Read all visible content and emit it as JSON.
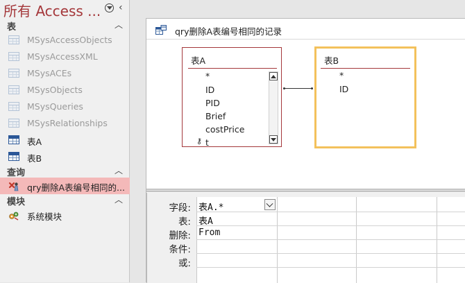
{
  "nav": {
    "title": "所有 Access ...",
    "groups": [
      {
        "label": "表",
        "items": [
          {
            "label": "MSysAccessObjects",
            "system": true
          },
          {
            "label": "MSysAccessXML",
            "system": true
          },
          {
            "label": "MSysACEs",
            "system": true
          },
          {
            "label": "MSysObjects",
            "system": true
          },
          {
            "label": "MSysQueries",
            "system": true
          },
          {
            "label": "MSysRelationships",
            "system": true
          },
          {
            "label": "表A",
            "system": false
          },
          {
            "label": "表B",
            "system": false
          }
        ]
      },
      {
        "label": "查询",
        "items": [
          {
            "label": "qry删除A表编号相同的...",
            "selected": true,
            "icon": "delete-query-icon"
          }
        ]
      },
      {
        "label": "模块",
        "items": [
          {
            "label": "系统模块",
            "icon": "module-icon"
          }
        ]
      }
    ]
  },
  "document": {
    "tab_label": "qry删除A表编号相同的记录",
    "tab_icon": "query-design-icon"
  },
  "diagram": {
    "tableA": {
      "title": "表A",
      "fields": [
        "*",
        "ID",
        "PID",
        "Brief",
        "costPrice",
        "t"
      ],
      "key_icon_on": "t"
    },
    "tableB": {
      "title": "表B",
      "fields": [
        "*",
        "ID"
      ],
      "selected": true
    },
    "join": {
      "from": "表A.ID",
      "to": "表B.ID"
    }
  },
  "grid": {
    "row_labels": [
      "字段:",
      "表:",
      "删除:",
      "条件:",
      "或:"
    ],
    "columns": [
      {
        "field": "表A.*",
        "table": "表A",
        "delete": "From",
        "criteria": "",
        "or": ""
      }
    ]
  },
  "colors": {
    "accent": "#a4373a",
    "selected_item_bg": "#f4b9b9",
    "selected_table_border": "#f3c15b"
  }
}
